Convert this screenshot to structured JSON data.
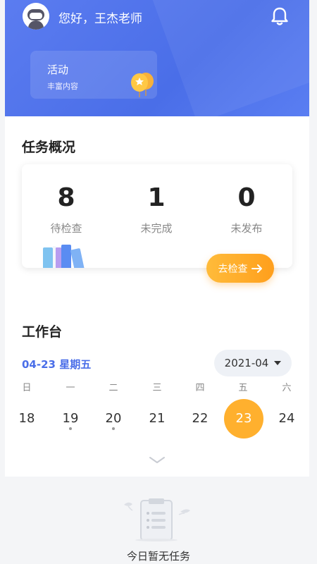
{
  "header": {
    "greeting": "您好，王杰老师",
    "activity_title": "活动",
    "activity_subtitle": "丰富内容"
  },
  "tasks": {
    "section_title": "任务概况",
    "stats": [
      {
        "value": "8",
        "label": "待检查"
      },
      {
        "value": "1",
        "label": "未完成"
      },
      {
        "value": "0",
        "label": "未发布"
      }
    ],
    "check_button": "去检查"
  },
  "workbench": {
    "section_title": "工作台",
    "current_date": "04-23 星期五",
    "month_selector": "2021-04",
    "weekdays": [
      "日",
      "一",
      "二",
      "三",
      "四",
      "五",
      "六"
    ],
    "days": [
      "18",
      "19",
      "20",
      "21",
      "22",
      "23",
      "24"
    ],
    "selected_day_index": 5,
    "days_with_dot": [
      "19",
      "20"
    ]
  },
  "empty_state": {
    "text": "今日暂无任务"
  },
  "colors": {
    "header_blue": "#4a6ee8",
    "accent_orange": "#ffb02e",
    "date_blue": "#4a6ee8"
  }
}
